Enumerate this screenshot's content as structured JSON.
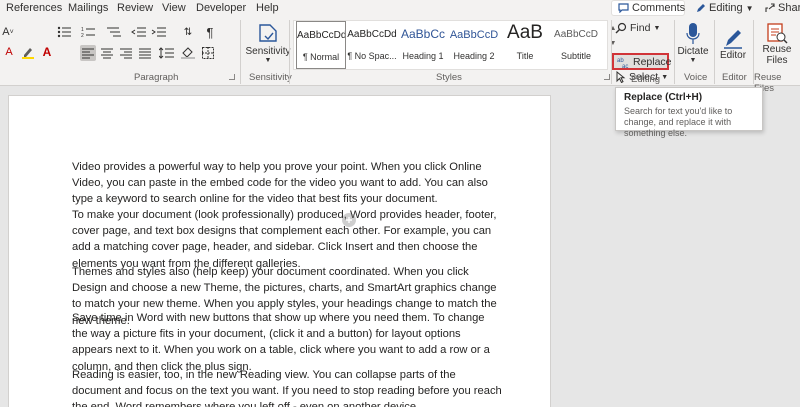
{
  "menu": {
    "tabs": [
      "References",
      "Mailings",
      "Review",
      "View",
      "Developer",
      "Help"
    ],
    "comments": "Comments",
    "editing": "Editing",
    "share": "Share"
  },
  "ribbon": {
    "groups": {
      "paragraph": "Paragraph",
      "sensitivity": "Sensitivity",
      "styles": "Styles",
      "editing": "Editing",
      "voice": "Voice",
      "editor": "Editor",
      "reuse_files": "Reuse Files"
    },
    "sensitivity_label": "Sensitivity",
    "styles": [
      {
        "sample": "AaBbCcDd",
        "name": "¶ Normal"
      },
      {
        "sample": "AaBbCcDd",
        "name": "¶ No Spac..."
      },
      {
        "sample": "AaBbCc",
        "name": "Heading 1"
      },
      {
        "sample": "AaBbCcD",
        "name": "Heading 2"
      },
      {
        "sample": "AaB",
        "name": "Title"
      },
      {
        "sample": "AaBbCcD",
        "name": "Subtitle"
      }
    ],
    "find": "Find",
    "replace": "Replace",
    "select": "Select",
    "dictate": "Dictate",
    "editor": "Editor",
    "reuse_files": "Reuse Files"
  },
  "tooltip": {
    "title": "Replace (Ctrl+H)",
    "description": "Search for text you'd like to change, and replace it with something else."
  },
  "document": {
    "paragraphs": [
      "Video provides a powerful way to help you prove your point. When you click Online Video, you can paste in the embed code for the video you want to add. You can also type a keyword to search online for the video that best fits your document.",
      "To make your document (look professionally) produced, Word provides header, footer, cover page, and text box designs that complement each other. For example, you can add a matching cover page, header, and sidebar. Click Insert and then choose the elements you want from the different galleries.",
      "Themes and styles also (help keep) your document coordinated. When you click Design and choose a new Theme, the pictures, charts, and SmartArt graphics change to match your new theme. When you apply styles, your headings change to match the new theme.",
      "Save time in Word with new buttons that show up where you need them. To change the way a picture fits in your document, (click it and a button) for layout options appears next to it. When you work on a table, click where you want to add a row or a column, and then click the plus sign.",
      "Reading is easier, too, in the new Reading view. You can collapse parts of the document and focus on the text you want. If you need to stop reading before you reach the end, Word remembers where you left off - even on another device."
    ]
  },
  "watermark": "kiwi.com",
  "colors": {
    "highlight_border": "#d13438",
    "ribbon_bg": "#f3f2f1",
    "canvas_bg": "#e6e6e6",
    "accent_blue": "#2b579a"
  }
}
